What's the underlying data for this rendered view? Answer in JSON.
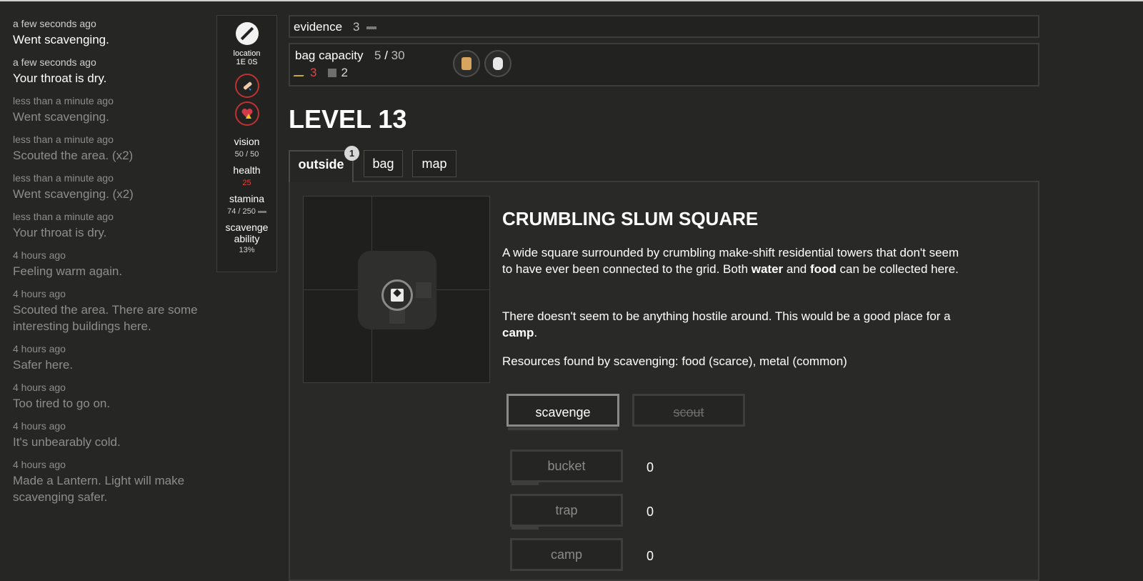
{
  "log": [
    {
      "time": "a few seconds ago",
      "text": "Went scavenging.",
      "old": false
    },
    {
      "time": "a few seconds ago",
      "text": "Your throat is dry.",
      "old": false
    },
    {
      "time": "less than a minute ago",
      "text": "Went scavenging.",
      "old": true
    },
    {
      "time": "less than a minute ago",
      "text": "Scouted the area. (x2)",
      "old": true
    },
    {
      "time": "less than a minute ago",
      "text": "Went scavenging. (x2)",
      "old": true
    },
    {
      "time": "less than a minute ago",
      "text": "Your throat is dry.",
      "old": true
    },
    {
      "time": "4 hours ago",
      "text": "Feeling warm again.",
      "old": true
    },
    {
      "time": "4 hours ago",
      "text": "Scouted the area. There are some interesting buildings here.",
      "old": true
    },
    {
      "time": "4 hours ago",
      "text": "Safer here.",
      "old": true
    },
    {
      "time": "4 hours ago",
      "text": "Too tired to go on.",
      "old": true
    },
    {
      "time": "4 hours ago",
      "text": "It's unbearably cold.",
      "old": true
    },
    {
      "time": "4 hours ago",
      "text": "Made a Lantern. Light will make scavenging safer.",
      "old": true
    }
  ],
  "status": {
    "location_label": "location",
    "location_value": "1E 0S",
    "vision_label": "vision",
    "vision_value": "50 / 50",
    "health_label": "health",
    "health_value": "25",
    "stamina_label": "stamina",
    "stamina_value": "74 / 250",
    "scavenge_label_1": "scavenge",
    "scavenge_label_2": "ability",
    "scavenge_value": "13%"
  },
  "evidence": {
    "label": "evidence",
    "value": "3"
  },
  "bag": {
    "label": "bag capacity",
    "used": "5",
    "sep": "/",
    "max": "30",
    "res_a": "3",
    "res_b": "2"
  },
  "level": {
    "title": "LEVEL 13"
  },
  "tabs": {
    "outside": "outside",
    "bag": "bag",
    "map": "map",
    "badge": "1"
  },
  "location": {
    "name": "CRUMBLING SLUM SQUARE",
    "desc1_a": "A wide square surrounded by crumbling make-shift residential towers that don't seem to have ever been connected to the grid. Both ",
    "desc1_b": "water",
    "desc1_c": " and ",
    "desc1_d": "food",
    "desc1_e": " can be collected here.",
    "desc2_a": "There doesn't seem to be anything hostile around. This would be a good place for a ",
    "desc2_b": "camp",
    "desc2_c": ".",
    "desc3": "Resources found by scavenging: food (scarce), metal (common)"
  },
  "actions": {
    "scavenge": "scavenge",
    "scout": "scout"
  },
  "buildings": [
    {
      "label": "bucket",
      "count": "0"
    },
    {
      "label": "trap",
      "count": "0"
    },
    {
      "label": "camp",
      "count": "0"
    }
  ],
  "colors": {
    "background": "#262725",
    "danger": "#e04444",
    "accent_gold": "#c9a93a"
  }
}
